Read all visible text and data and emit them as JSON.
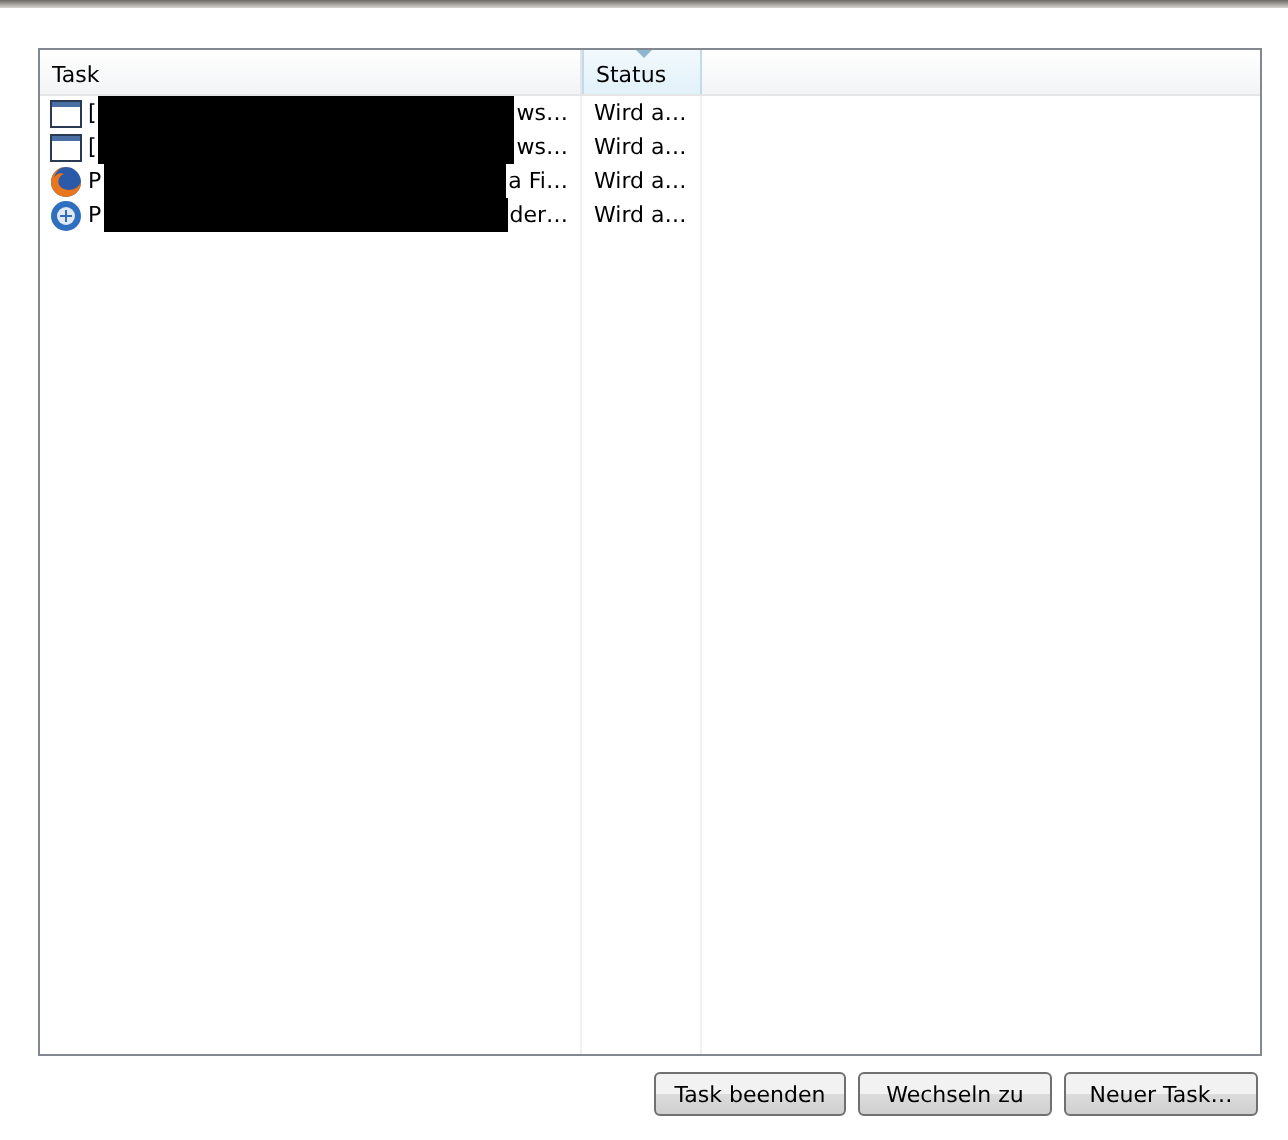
{
  "columns": [
    {
      "label": "Task",
      "sorted": false
    },
    {
      "label": "Status",
      "sorted": true
    }
  ],
  "rows": [
    {
      "kind": "window",
      "task_start": "[",
      "task_end": "ws…",
      "status": "Wird a…"
    },
    {
      "kind": "window",
      "task_start": "[",
      "task_end": "ws…",
      "status": "Wird a…"
    },
    {
      "kind": "orange-globe",
      "task_start": "P",
      "task_end": "a Fi…",
      "status": "Wird a…"
    },
    {
      "kind": "blue-globe",
      "task_start": "P",
      "task_end": "der…",
      "status": "Wird a…"
    }
  ],
  "redaction": true,
  "buttons": [
    "Task beenden",
    "Wechseln zu",
    "Neuer Task…"
  ]
}
